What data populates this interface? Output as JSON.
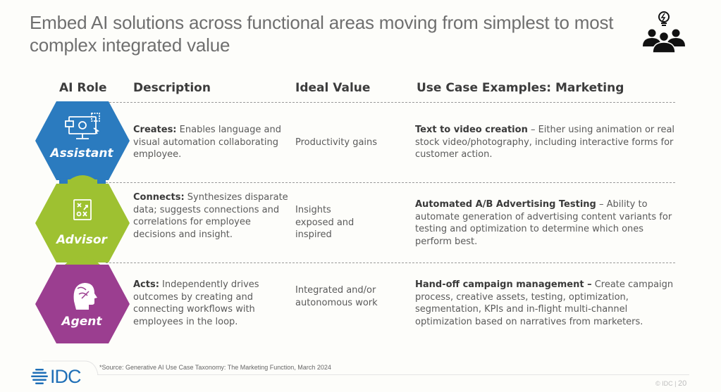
{
  "slide": {
    "title": "Embed AI solutions across functional areas moving from simplest to most complex integrated value",
    "header_icon": "team-lightbulb-icon"
  },
  "table": {
    "headers": {
      "role": "AI Role",
      "description": "Description",
      "value": "Ideal Value",
      "use_case": "Use Case Examples: Marketing"
    },
    "rows": [
      {
        "role": "Assistant",
        "role_color": "#2b7bbf",
        "role_icon": "computer-user-icon",
        "desc_bold": "Creates:",
        "desc_text": " Enables language and visual automation collaborating employee.",
        "value": "Productivity gains",
        "use_bold": "Text to video creation",
        "use_text": " – Either using animation or real stock video/photography, including interactive forms for customer action."
      },
      {
        "role": "Advisor",
        "role_color": "#9ec131",
        "role_icon": "strategy-board-icon",
        "desc_bold": "Connects:",
        "desc_text": " Synthesizes disparate data; suggests connections and correlations for employee decisions and insight.",
        "value": "Insights exposed and inspired",
        "use_bold": "Automated A/B Advertising Testing",
        "use_text": " – Ability to automate generation of advertising content variants for testing and optimization to determine which ones perform best."
      },
      {
        "role": "Agent",
        "role_color": "#9b3e90",
        "role_icon": "brain-head-icon",
        "desc_bold": "Acts:",
        "desc_text": " Independently drives outcomes by creating and connecting workflows with employees in the loop.",
        "value": "Integrated and/or autonomous work",
        "use_bold": "Hand-off campaign management –",
        "use_text": " Create campaign process, creative assets, testing, optimization, segmentation, KPIs and in-flight multi-channel optimization based on narratives from marketers."
      }
    ]
  },
  "footer": {
    "source": "*Source: Generative AI Use Case Taxonomy: The Marketing Function, March 2024",
    "logo": "IDC",
    "copyright": "© IDC |",
    "page": "20"
  }
}
